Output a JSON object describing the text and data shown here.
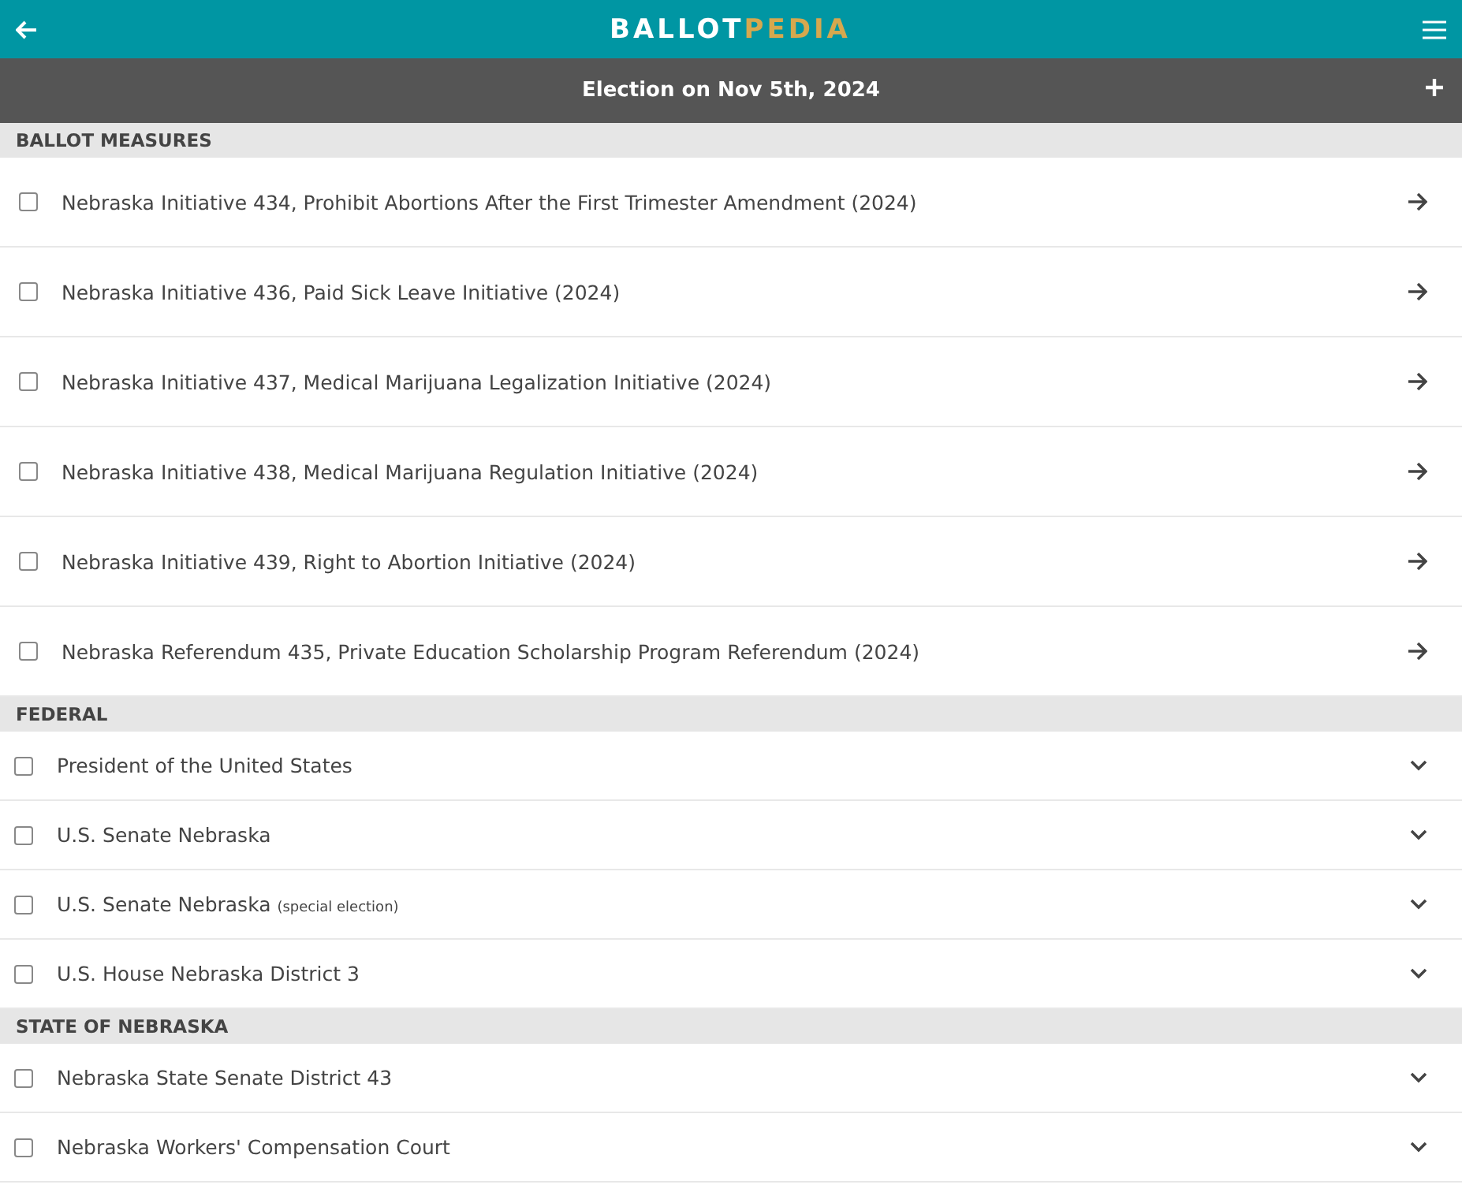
{
  "header": {
    "logo": [
      "BALLOT",
      "PEDIA"
    ]
  },
  "election": {
    "title": "Election on Nov 5th, 2024"
  },
  "sections": [
    {
      "title": "BALLOT MEASURES",
      "items": [
        {
          "kind": "measure",
          "label": "Nebraska Initiative 434, Prohibit Abortions After the First Trimester Amendment (2024)",
          "checked": false
        },
        {
          "kind": "measure",
          "label": "Nebraska Initiative 436, Paid Sick Leave Initiative (2024)",
          "checked": false
        },
        {
          "kind": "measure",
          "label": "Nebraska Initiative 437, Medical Marijuana Legalization Initiative (2024)",
          "checked": false
        },
        {
          "kind": "measure",
          "label": "Nebraska Initiative 438, Medical Marijuana Regulation Initiative (2024)",
          "checked": false
        },
        {
          "kind": "measure",
          "label": "Nebraska Initiative 439, Right to Abortion Initiative (2024)",
          "checked": false
        },
        {
          "kind": "measure",
          "label": "Nebraska Referendum 435, Private Education Scholarship Program Referendum (2024)",
          "checked": false
        }
      ]
    },
    {
      "title": "FEDERAL",
      "items": [
        {
          "kind": "race",
          "label": "President of the United States",
          "checked": false
        },
        {
          "kind": "race",
          "label": "U.S. Senate Nebraska",
          "checked": false
        },
        {
          "kind": "race",
          "label": "U.S. Senate Nebraska",
          "note": "(special election)",
          "checked": false
        },
        {
          "kind": "race",
          "label": "U.S. House Nebraska District 3",
          "checked": false
        }
      ]
    },
    {
      "title": "STATE OF NEBRASKA",
      "items": [
        {
          "kind": "race",
          "label": "Nebraska State Senate District 43",
          "checked": false
        },
        {
          "kind": "race",
          "label": "Nebraska Workers' Compensation Court",
          "checked": false
        }
      ]
    }
  ]
}
